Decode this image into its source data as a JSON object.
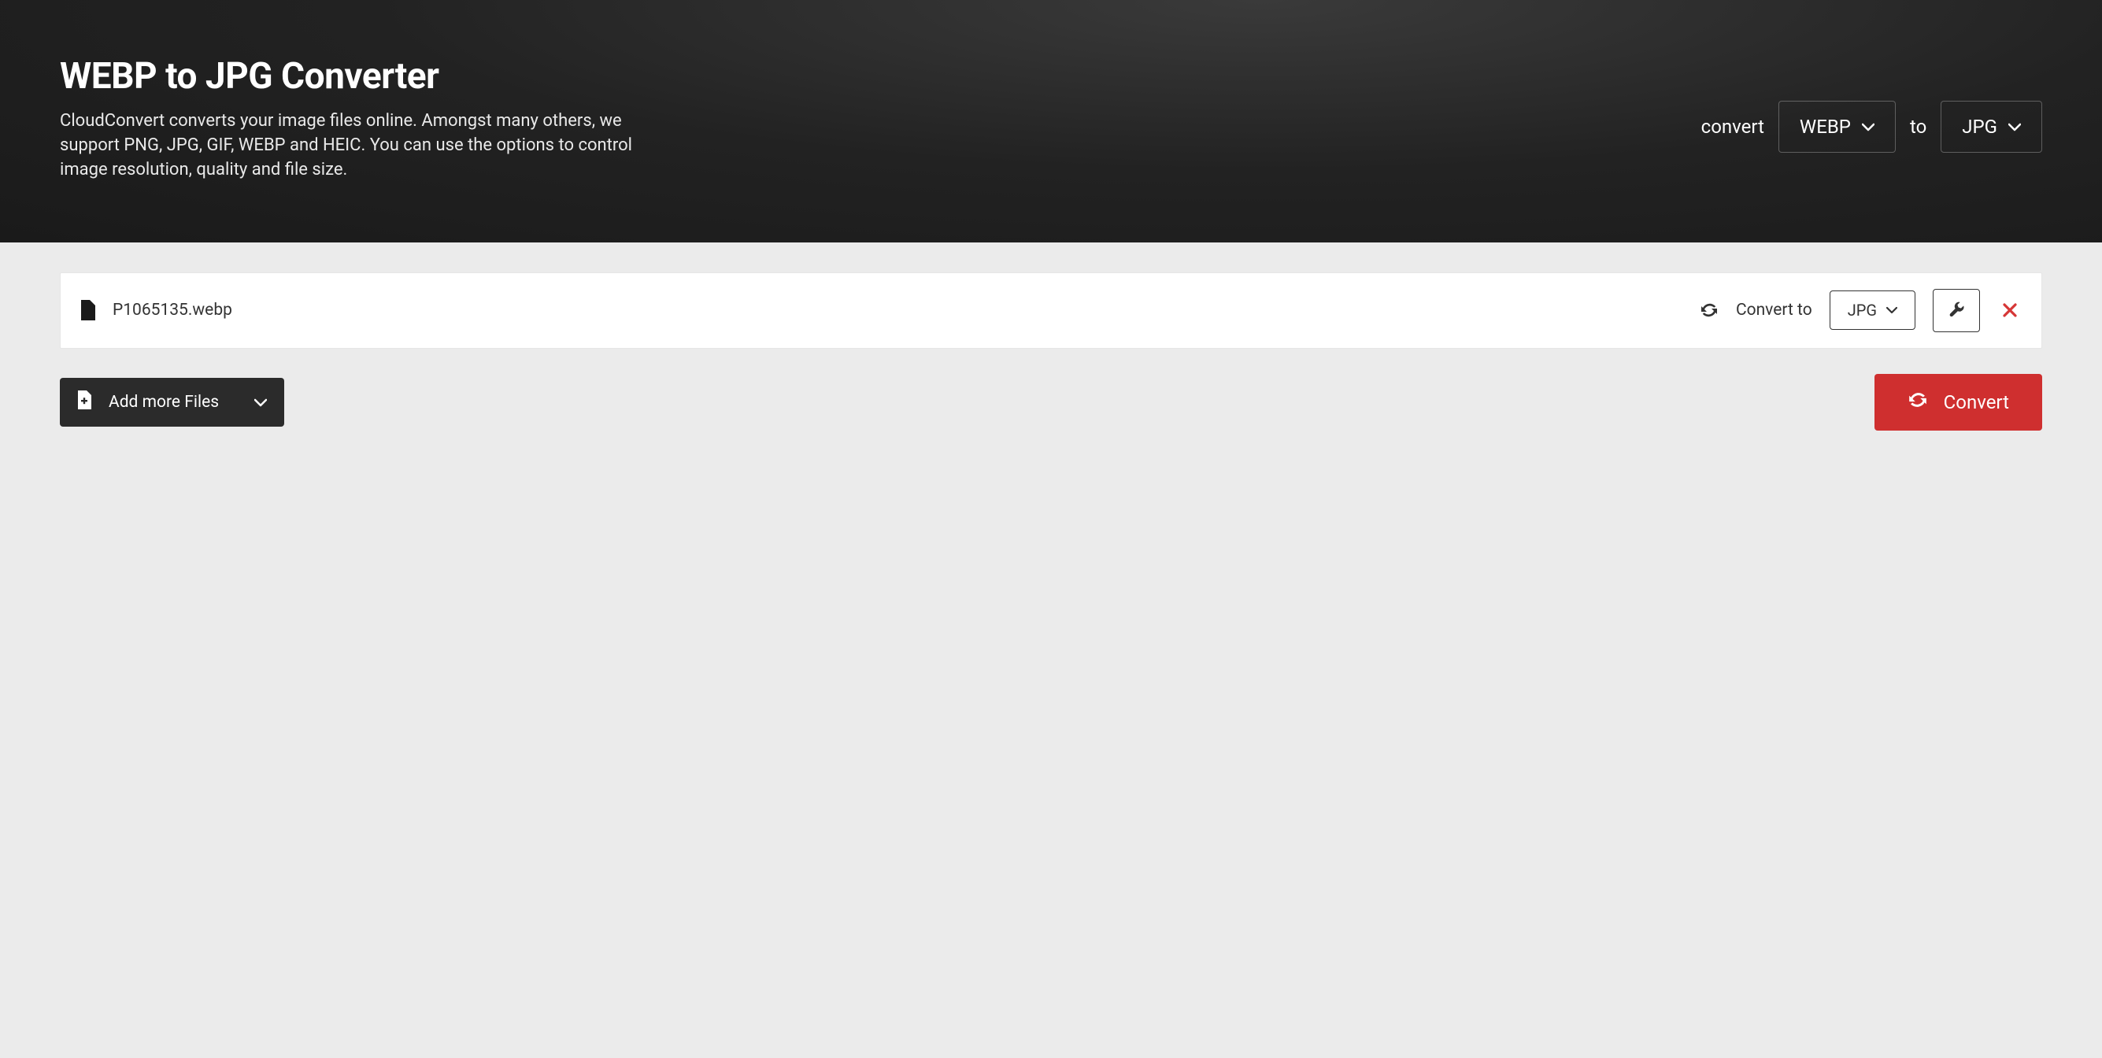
{
  "hero": {
    "title": "WEBP to JPG Converter",
    "description": "CloudConvert converts your image files online. Amongst many others, we support PNG, JPG, GIF, WEBP and HEIC. You can use the options to control image resolution, quality and file size.",
    "convert_label": "convert",
    "from_format": "WEBP",
    "to_label": "to",
    "to_format": "JPG"
  },
  "file": {
    "name": "P1065135.webp",
    "convert_to_label": "Convert to",
    "target_format": "JPG"
  },
  "actions": {
    "add_more_label": "Add more Files",
    "convert_label": "Convert"
  }
}
